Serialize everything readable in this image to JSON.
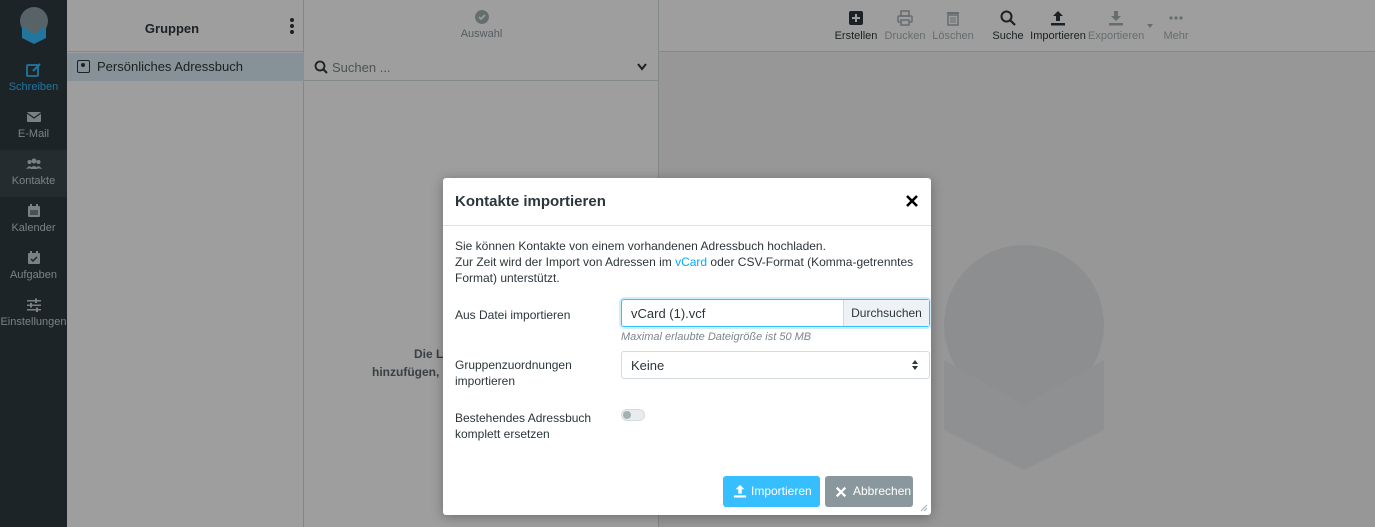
{
  "nav": {
    "items": [
      {
        "label": "Schreiben",
        "icon": "compose-icon"
      },
      {
        "label": "E-Mail",
        "icon": "envelope-icon"
      },
      {
        "label": "Kontakte",
        "icon": "users-icon"
      },
      {
        "label": "Kalender",
        "icon": "calendar-icon"
      },
      {
        "label": "Aufgaben",
        "icon": "tasks-icon"
      },
      {
        "label": "Einstellungen",
        "icon": "sliders-icon"
      }
    ]
  },
  "groups": {
    "title": "Gruppen",
    "items": [
      {
        "label": "Persönliches Adressbuch"
      }
    ]
  },
  "list": {
    "select_label": "Auswahl",
    "search_placeholder": "Suchen ...",
    "empty_line1": "Die Liste ist le",
    "empty_line2": "hinzufügen, verw"
  },
  "toolbar": {
    "create": "Erstellen",
    "print": "Drucken",
    "delete": "Löschen",
    "search": "Suche",
    "import": "Importieren",
    "export": "Exportieren",
    "more": "Mehr"
  },
  "dialog": {
    "title": "Kontakte importieren",
    "intro_line1": "Sie können Kontakte von einem vorhandenen Adressbuch hochladen.",
    "intro_line2_pre": "Zur Zeit wird der Import von Adressen im ",
    "intro_link": "vCard",
    "intro_line2_post": " oder CSV-Format (Komma-getrenntes",
    "intro_line3": "Format) unterstützt.",
    "file_label": "Aus Datei importieren",
    "file_value": "vCard (1).vcf",
    "browse_label": "Durchsuchen",
    "file_hint": "Maximal erlaubte Dateigröße ist 50 MB",
    "groups_label_line1": "Gruppenzuordnungen",
    "groups_label_line2": "importieren",
    "groups_value": "Keine",
    "replace_label_line1": "Bestehendes Adressbuch",
    "replace_label_line2": "komplett ersetzen",
    "import_button": "Importieren",
    "cancel_button": "Abbrechen"
  },
  "colors": {
    "accent": "#37beff",
    "nav_bg": "#2f3a3f"
  }
}
